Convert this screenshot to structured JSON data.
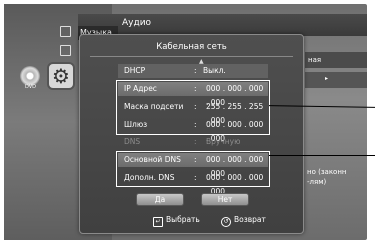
{
  "background": {
    "header_label": "Аудио",
    "menu_item": "Музыка",
    "disc_label": "DVD",
    "right_text_1": "ная",
    "right_text_2": "но (законн",
    "right_text_3": "-лям)"
  },
  "dialog": {
    "title": "Кабельная сеть",
    "up_arrow": "▲",
    "down_arrow": "▼",
    "rows": [
      {
        "label": "DHCP",
        "colon": ":",
        "value": "Выкл."
      },
      {
        "label": "IP Адрес",
        "colon": ":",
        "value": "000 . 000 . 000 . 000"
      },
      {
        "label": "Маска подсети",
        "colon": ":",
        "value": "255 . 255 . 255 . 000"
      },
      {
        "label": "Шлюз",
        "colon": ":",
        "value": "000 . 000 . 000 . 000"
      },
      {
        "label": "DNS",
        "colon": ":",
        "value": "Вручную"
      },
      {
        "label": "Основной DNS",
        "colon": ":",
        "value": "000 . 000 . 000 . 000"
      },
      {
        "label": "Дополн. DNS",
        "colon": ":",
        "value": "000 . 000 . 000 . 000"
      }
    ],
    "buttons": {
      "yes": "Да",
      "no": "Нет"
    }
  },
  "footer": {
    "select_label": "Выбрать",
    "return_label": "Возврат"
  }
}
